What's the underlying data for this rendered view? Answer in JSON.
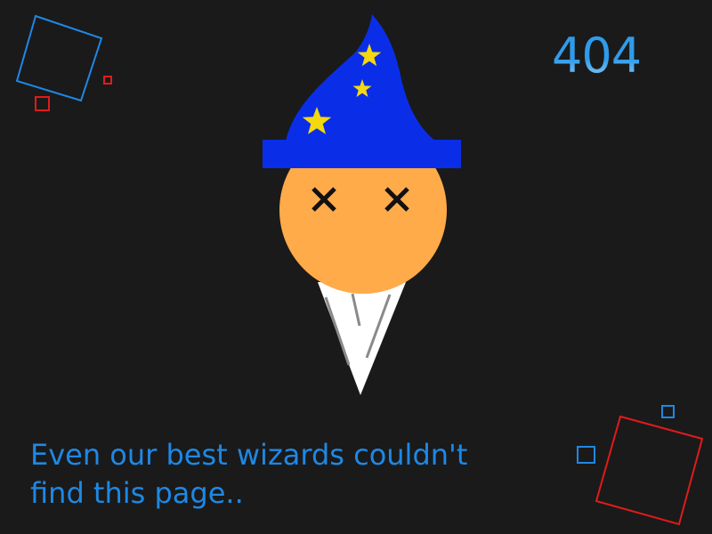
{
  "error": {
    "code": "404",
    "message": "Even our best wizards couldn't find this page.."
  },
  "colors": {
    "background": "#1a1a1a",
    "accent_blue": "#1e88e5",
    "hat_blue": "#0a2ee8",
    "star_yellow": "#f5d80f",
    "face_orange": "#ffab4a",
    "deco_red": "#e11b1b",
    "deco_blue": "#1e88e5"
  },
  "illustration": {
    "name": "wizard-ice-cream-cone",
    "icons": [
      "wizard-hat-icon",
      "star-icon",
      "dead-eyes-icon",
      "cone-icon"
    ]
  }
}
